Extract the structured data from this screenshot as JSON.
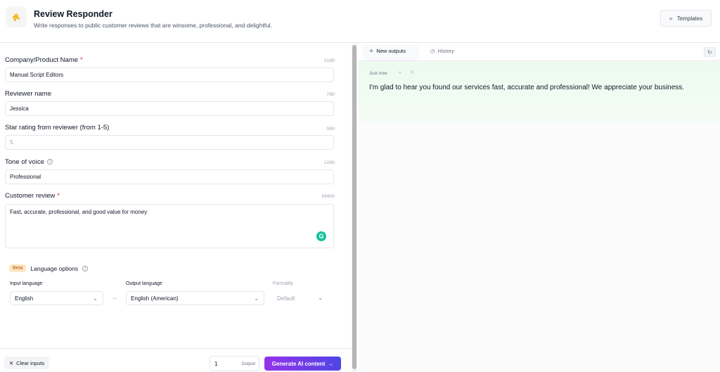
{
  "header": {
    "title": "Review Responder",
    "subtitle": "Write responses to public customer reviews that are winsome, professional, and delightful.",
    "templates_label": "Templates",
    "logo_icon": "megaphone-icon"
  },
  "form": {
    "company": {
      "label": "Company/Product Name",
      "required": "*",
      "counter": "21/80",
      "value": "Manual Script Editors"
    },
    "reviewer": {
      "label": "Reviewer name",
      "counter": "7/80",
      "value": "Jessica"
    },
    "rating": {
      "label": "Star rating from reviewer (from 1-5)",
      "counter": "0/80",
      "placeholder": "5"
    },
    "tone": {
      "label": "Tone of voice",
      "counter": "12/80",
      "value": "Professional"
    },
    "review": {
      "label": "Customer review",
      "required": "*",
      "counter": "54/600",
      "value": "Fast, accurate, professional, and good value for money"
    }
  },
  "language": {
    "badge": "Beta",
    "title": "Language options",
    "input_label": "Input language",
    "input_value": "English",
    "output_label": "Output language",
    "output_value": "English (American)",
    "formality_label": "Formality",
    "formality_value": "Default"
  },
  "bottom": {
    "clear_label": "Clear inputs",
    "output_count": "1",
    "output_label": "Output",
    "generate_label": "Generate AI content"
  },
  "outputs": {
    "tab_new": "New outputs",
    "tab_history": "History",
    "timestamp": "Just now",
    "text": "I'm glad to hear you found our services fast, accurate and professional! We appreciate your business."
  },
  "colors": {
    "accent_start": "#9333ea",
    "accent_end": "#4f46e5",
    "output_bg": "#ecfbee",
    "grammarly": "#15c39a",
    "beta_bg": "#fde7c2"
  }
}
